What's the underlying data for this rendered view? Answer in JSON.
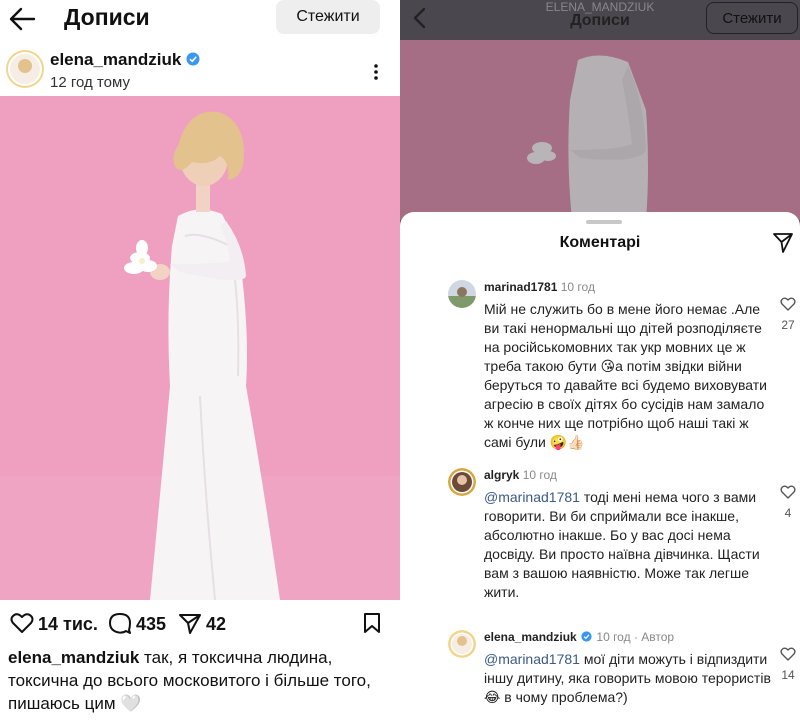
{
  "left": {
    "header": {
      "title": "Дописи",
      "follow_label": "Стежити"
    },
    "post": {
      "author": "elena_mandziuk",
      "time": "12 год тому",
      "likes": "14 тис.",
      "comments": "435",
      "shares": "42",
      "caption_user": "elena_mandziuk",
      "caption_text": " так, я токсична людина, токсична до всього московитого і більше того, пишаюсь цим 🤍"
    }
  },
  "right": {
    "header": {
      "username": "ELENA_MANDZIUK",
      "title": "Дописи",
      "follow_label": "Стежити"
    },
    "sheet": {
      "title": "Коментарі",
      "comments": [
        {
          "user": "marinad1781",
          "time": "10 год",
          "text": "Мій не служить бо в мене його немає .Але ви такі ненормальні що дітей розподіляєте на російськомовних так укр мовних це ж треба такою бути 😘а потім звідки війни беруться то давайте всі будемо виховувати агресію в своїх дітях бо сусідів нам замало ж конче них ще потрібно щоб наші такі ж самі були 🤪👍🏻",
          "likes": "27"
        },
        {
          "user": "algryk",
          "time": "10 год",
          "mention": "@marinad1781",
          "text": " тоді мені нема чого з вами говорити. Ви би сприймали все інакше, абсолютно інакше. Бо у вас досі нема досвіду. Ви просто наївна дівчинка. Щасти вам з вашою наявністю. Може так легше жити.",
          "likes": "4"
        },
        {
          "user": "elena_mandziuk",
          "time": "10 год",
          "author_tag": "· Автор",
          "mention": "@marinad1781",
          "text": " мої діти можуть і відпиздити іншу дитину, яка говорить мовою терористів 😂 в чому проблема?)",
          "likes": "14"
        }
      ]
    }
  },
  "colors": {
    "photo_pink": "#ef9fc0",
    "mention_blue": "#3b5a85",
    "verified_blue": "#3897f0",
    "overlay": "#54515a"
  },
  "icons": [
    "back-arrow-icon",
    "verified-icon",
    "more-icon",
    "heart-icon",
    "comment-icon",
    "share-icon",
    "bookmark-icon",
    "send-icon"
  ]
}
